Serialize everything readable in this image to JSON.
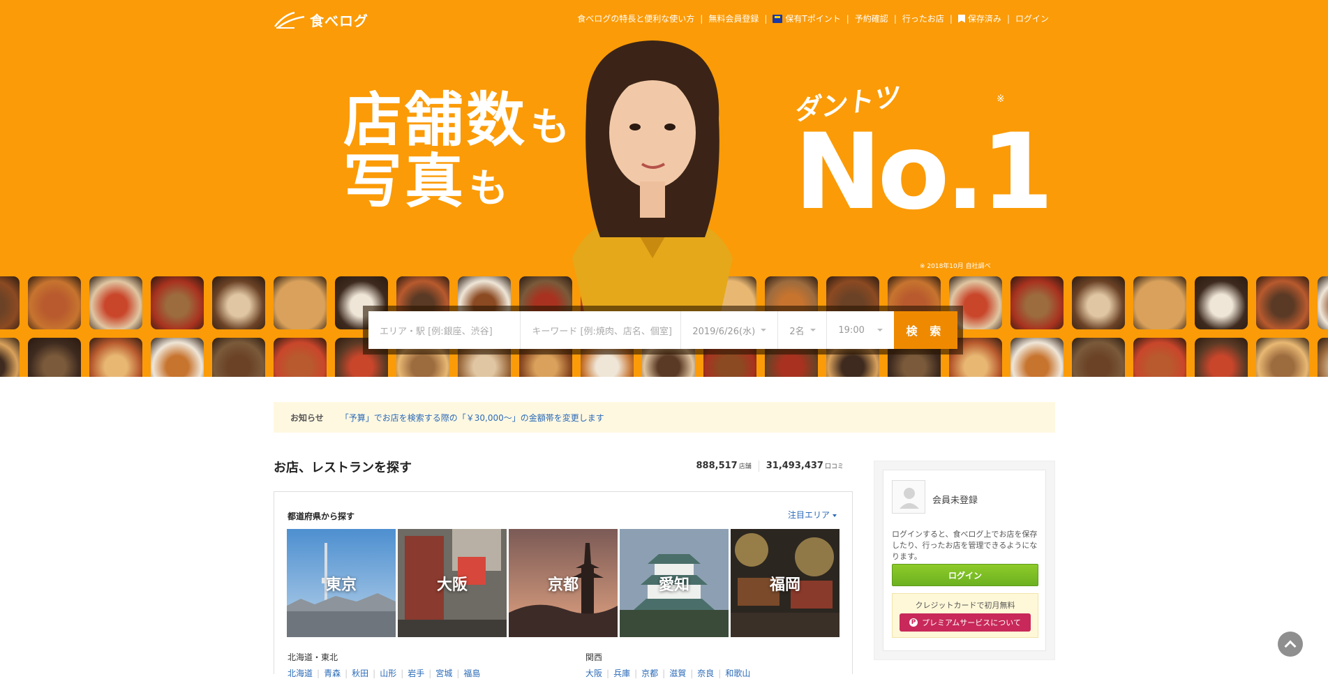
{
  "header": {
    "logo_text": "食べログ",
    "nav": [
      {
        "label": "食べログの特長と便利な使い方"
      },
      {
        "label": "無料会員登録"
      },
      {
        "label": "保有Tポイント"
      },
      {
        "label": "予約確認"
      },
      {
        "label": "行ったお店"
      },
      {
        "label": "保存済み"
      },
      {
        "label": "ログイン"
      }
    ]
  },
  "hero": {
    "line1_big": "店舗数",
    "line1_small": "も",
    "line2_big": "写真",
    "line2_small": "も",
    "dantotsu": "ダントツ",
    "no1": "No.1",
    "asterisk": "※",
    "footnote": "※ 2018年10月 自社調べ"
  },
  "search": {
    "area_placeholder": "エリア・駅 [例:銀座、渋谷]",
    "keyword_placeholder": "キーワード [例:焼肉、店名、個室]",
    "date": "2019/6/26(水)",
    "people": "2名",
    "time": "19:00",
    "button": "検 索"
  },
  "notice": {
    "label": "お知らせ",
    "text": "「予算」でお店を検索する際の「￥30,000〜」の金額帯を変更します"
  },
  "main": {
    "title": "お店、レストランを探す",
    "stores_count": "888,517",
    "stores_unit": "店舗",
    "reviews_count": "31,493,437",
    "reviews_unit": "口コミ",
    "card_title": "都道府県から探す",
    "featured_label": "注目エリア",
    "prefectures": [
      {
        "name": "東京"
      },
      {
        "name": "大阪"
      },
      {
        "name": "京都"
      },
      {
        "name": "愛知"
      },
      {
        "name": "福岡"
      }
    ],
    "region_hokkaido": {
      "name": "北海道・東北",
      "items": [
        "北海道",
        "青森",
        "秋田",
        "山形",
        "岩手",
        "宮城",
        "福島"
      ]
    },
    "region_kansai": {
      "name": "関西",
      "items": [
        "大阪",
        "兵庫",
        "京都",
        "滋賀",
        "奈良",
        "和歌山"
      ]
    }
  },
  "sidebar": {
    "member_status": "会員未登録",
    "description": "ログインすると、食べログ上でお店を保存したり、行ったお店を管理できるようになります。",
    "login_button": "ログイン",
    "premium_text": "クレジットカードで初月無料",
    "premium_button": "プレミアムサービスについて",
    "premium_icon_letter": "P"
  },
  "colors": {
    "brand_orange": "#fb9b07",
    "search_button": "#ef8a00",
    "link_blue": "#2a6ab8",
    "login_green": "#6cb120",
    "premium_pink": "#c8285a"
  }
}
